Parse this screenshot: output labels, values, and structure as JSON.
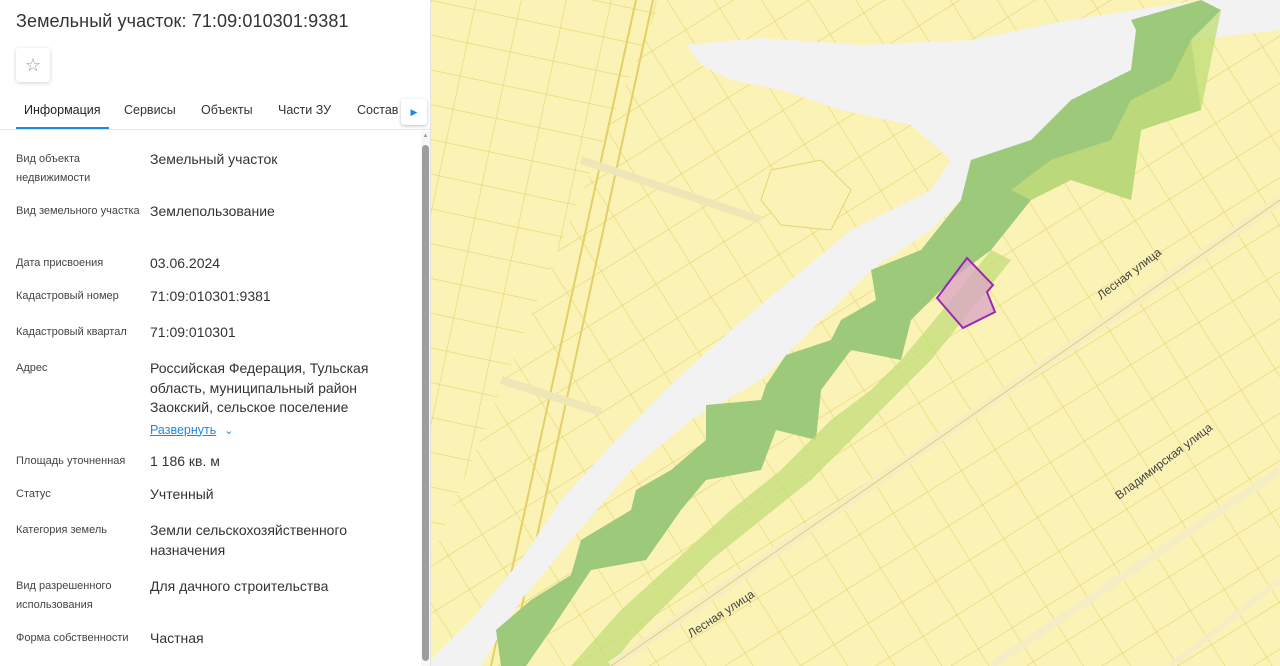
{
  "title": "Земельный участок: 71:09:010301:9381",
  "favorite_icon": "star-outline-icon",
  "tabs": [
    {
      "label": "Информация",
      "active": true
    },
    {
      "label": "Сервисы",
      "active": false
    },
    {
      "label": "Объекты",
      "active": false
    },
    {
      "label": "Части ЗУ",
      "active": false
    },
    {
      "label": "Состав",
      "active": false
    }
  ],
  "tab_scroll_icon": "caret-right-icon",
  "info": {
    "object_type": {
      "label": "Вид объекта недвижимости",
      "value": "Земельный участок"
    },
    "parcel_type": {
      "label": "Вид земельного участка",
      "value": "Землепользование"
    },
    "assign_date": {
      "label": "Дата присвоения",
      "value": "03.06.2024"
    },
    "cadastral_number": {
      "label": "Кадастровый номер",
      "value": "71:09:010301:9381"
    },
    "cadastral_quarter": {
      "label": "Кадастровый квартал",
      "value": "71:09:010301"
    },
    "address": {
      "label": "Адрес",
      "value": "Российская Федерация, Тульская область, муниципальный район Заокский, сельское поселение",
      "expand_label": "Развернуть"
    },
    "area": {
      "label": "Площадь уточненная",
      "value": "1 186 кв. м"
    },
    "status": {
      "label": "Статус",
      "value": "Учтенный"
    },
    "land_category": {
      "label": "Категория земель",
      "value": "Земли сельскохозяйственного назначения"
    },
    "permitted_use": {
      "label": "Вид разрешенного использования",
      "value": "Для дачного строительства"
    },
    "ownership": {
      "label": "Форма собственности",
      "value": "Частная"
    }
  },
  "map": {
    "street_labels": [
      "Лесная улица",
      "Лесная улица",
      "Владимирская улица"
    ],
    "colors": {
      "land": "#fbf3b5",
      "parcel_line": "#e9d66a",
      "river": "#f2f2f2",
      "forest": "#9cc97a",
      "forest_light": "#c3dd7a",
      "selected_stroke": "#9c27b0",
      "selected_fill": "#d9a3c8"
    }
  }
}
